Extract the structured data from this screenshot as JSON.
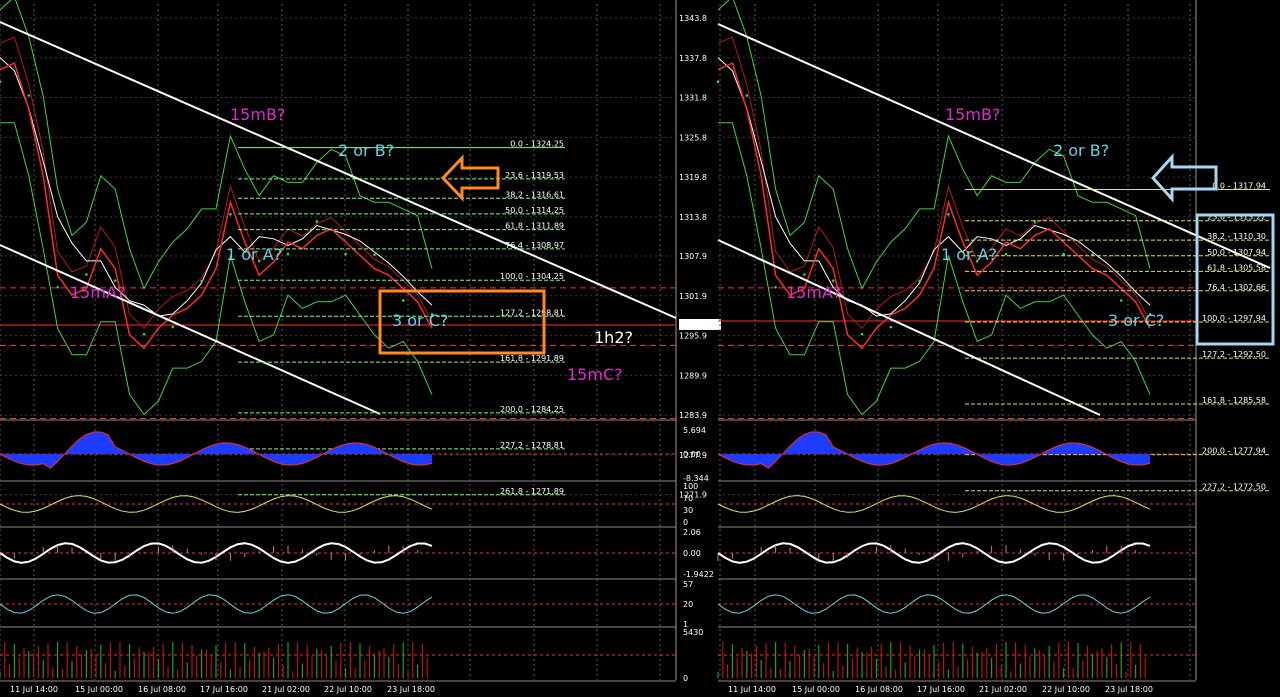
{
  "colors": {
    "background": "#000000",
    "grid": "#5a5a5a",
    "price": "#ff2a2a",
    "band": "#3dd63d",
    "fib_green": "#7cfc7c",
    "fib_yellow": "#e8e04a",
    "magenta": "#e02ad0",
    "cyan": "#5fd6e6",
    "orange": "#ff8a1e",
    "light_blue": "#a8d8f0",
    "osc_blue": "#1e3cff",
    "white": "#ffffff"
  },
  "chart_data": [
    {
      "type": "line",
      "panel": "left",
      "price_axis": {
        "ticks": [
          "1343.8",
          "1337.8",
          "1331.8",
          "1325.8",
          "1319.8",
          "1313.8",
          "1307.9",
          "1301.9",
          "1295.9",
          "1289.9",
          "1283.9",
          "1277.9",
          "1271.9"
        ],
        "current": "1297.5"
      },
      "time_axis": [
        "11 Jul 14:00",
        "15 Jul 00:00",
        "16 Jul 08:00",
        "17 Jul 16:00",
        "21 Jul 02:00",
        "22 Jul 10:00",
        "23 Jul 18:00"
      ],
      "fib_levels": [
        {
          "label": "0.0 - 1324.25",
          "price": 1324.25
        },
        {
          "label": "23.6 - 1319.53",
          "price": 1319.53
        },
        {
          "label": "38.2 - 1316.61",
          "price": 1316.61
        },
        {
          "label": "50.0 - 1314.25",
          "price": 1314.25
        },
        {
          "label": "61.8 - 1311.89",
          "price": 1311.89
        },
        {
          "label": "76.4 - 1308.97",
          "price": 1308.97
        },
        {
          "label": "100.0 - 1304.25",
          "price": 1304.25
        },
        {
          "label": "127.2 - 1298.81",
          "price": 1298.81
        },
        {
          "label": "161.8 - 1291.89",
          "price": 1291.89
        },
        {
          "label": "200.0 - 1284.25",
          "price": 1284.25
        },
        {
          "label": "227.2 - 1278.81",
          "price": 1278.81
        },
        {
          "label": "261.8 - 1271.89",
          "price": 1271.89
        }
      ],
      "annotations": [
        "15mB?",
        "2 or B?",
        "1 or A?",
        "15mA?",
        "3 or C?",
        "1h2?",
        "15mC?"
      ],
      "indicators": [
        {
          "ticks": [
            "5.694",
            "0.00",
            "-8.344"
          ]
        },
        {
          "ticks": [
            "100",
            "70",
            "30",
            "0"
          ]
        },
        {
          "ticks": [
            "2.06",
            "0.00",
            "-1.9422"
          ]
        },
        {
          "ticks": [
            "57",
            "20",
            "1"
          ]
        },
        {
          "ticks": [
            "5430",
            "0"
          ]
        }
      ]
    },
    {
      "type": "line",
      "panel": "right",
      "time_axis": [
        "11 Jul 14:00",
        "15 Jul 00:00",
        "16 Jul 08:00",
        "17 Jul 16:00",
        "21 Jul 02:00",
        "22 Jul 10:00",
        "23 Jul 18:00"
      ],
      "fib_levels": [
        {
          "label": "0.0 - 1317.94",
          "price": 1317.94
        },
        {
          "label": "23.6 - 1313.22",
          "price": 1313.22
        },
        {
          "label": "38.2 - 1310.30",
          "price": 1310.3
        },
        {
          "label": "50.0 - 1307.94",
          "price": 1307.94
        },
        {
          "label": "61.8 - 1305.58",
          "price": 1305.58
        },
        {
          "label": "76.4 - 1302.66",
          "price": 1302.66
        },
        {
          "label": "100.0 - 1297.94",
          "price": 1297.94
        },
        {
          "label": "127.2 - 1292.50",
          "price": 1292.5
        },
        {
          "label": "161.8 - 1285.58",
          "price": 1285.58
        },
        {
          "label": "200.0 - 1277.94",
          "price": 1277.94
        },
        {
          "label": "227.2 - 1272.50",
          "price": 1272.5
        }
      ],
      "annotations": [
        "15mB?",
        "2 or B?",
        "1 or A?",
        "15mA?",
        "3 or C?"
      ]
    }
  ]
}
